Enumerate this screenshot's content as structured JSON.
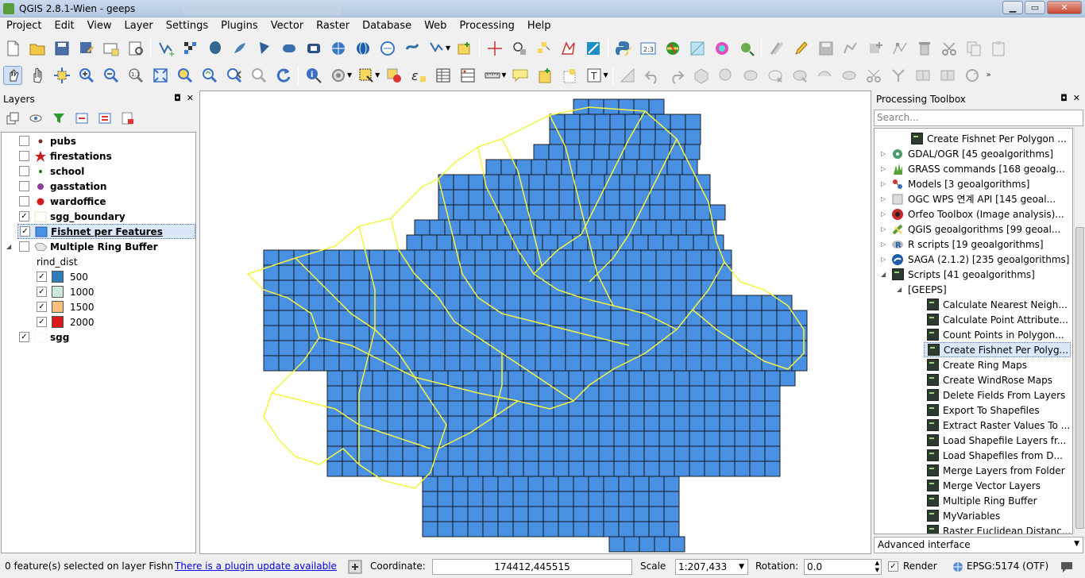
{
  "window": {
    "title": "QGIS 2.8.1-Wien - geeps",
    "minimize": "▁",
    "maximize": "▭",
    "close": "✕"
  },
  "menu": [
    "Project",
    "Edit",
    "View",
    "Layer",
    "Settings",
    "Plugins",
    "Vector",
    "Raster",
    "Database",
    "Web",
    "Processing",
    "Help"
  ],
  "layers_panel": {
    "title": "Layers",
    "float": "◘",
    "close": "✕",
    "layers": [
      {
        "name": "pubs",
        "checked": false,
        "symbol": "dot-brown"
      },
      {
        "name": "firestations",
        "checked": false,
        "symbol": "star-red"
      },
      {
        "name": "school",
        "checked": false,
        "symbol": "dot-green-small"
      },
      {
        "name": "gasstation",
        "checked": false,
        "symbol": "dot-purple"
      },
      {
        "name": "wardoffice",
        "checked": false,
        "symbol": "dot-red"
      },
      {
        "name": "sgg_boundary",
        "checked": true,
        "symbol": "fill-white"
      },
      {
        "name": "Fishnet per Features",
        "checked": true,
        "symbol": "fill-blue"
      },
      {
        "name": "Multiple Ring Buffer",
        "checked": false,
        "symbol": "polygon-group"
      },
      {
        "name": "sgg",
        "checked": true,
        "symbol": "fill-white"
      }
    ],
    "ring_field": "rind_dist",
    "classes": [
      {
        "label": "500",
        "color": "#2e7db8"
      },
      {
        "label": "1000",
        "color": "#cde9d9"
      },
      {
        "label": "1500",
        "color": "#fbc07c"
      },
      {
        "label": "2000",
        "color": "#d7191c"
      }
    ]
  },
  "processing": {
    "title": "Processing Toolbox",
    "search_placeholder": "Search...",
    "top_item": "Create Fishnet Per Polygon ...",
    "providers": [
      {
        "label": "GDAL/OGR [45 geoalgorithms]",
        "icon": "gdal-icon"
      },
      {
        "label": "GRASS commands [168 geoalg...",
        "icon": "grass-icon"
      },
      {
        "label": "Models [3 geoalgorithms]",
        "icon": "models-icon"
      },
      {
        "label": "OGC WPS 연계 API [145 geoal...",
        "icon": "ogc-wps-icon"
      },
      {
        "label": "Orfeo Toolbox (Image analysis)...",
        "icon": "orfeo-icon"
      },
      {
        "label": "QGIS geoalgorithms [99 geoal...",
        "icon": "qgis-icon"
      },
      {
        "label": "R scripts [19 geoalgorithms]",
        "icon": "r-icon"
      },
      {
        "label": "SAGA (2.1.2) [235 geoalgorithms]",
        "icon": "saga-icon"
      },
      {
        "label": "Scripts [41 geoalgorithms]",
        "icon": "scripts-icon"
      }
    ],
    "group": "[GEEPS]",
    "scripts": [
      "Calculate Nearest Neigh...",
      "Calculate Point Attribute...",
      "Count Points in Polygon...",
      "Create Fishnet Per Polyg...",
      "Create Ring Maps",
      "Create WindRose Maps",
      "Delete Fields From Layers",
      "Export To Shapefiles",
      "Extract Raster Values To ...",
      "Load Shapefile Layers fr...",
      "Load Shapefiles from D...",
      "Merge Layers from Folder",
      "Merge Vector Layers",
      "Multiple Ring Buffer",
      "MyVariables",
      "Raster Euclidean Distanc..."
    ],
    "mode": "Advanced interface"
  },
  "status": {
    "selection": "0 feature(s) selected on layer Fishn",
    "plugin_update": "There is a plugin update available",
    "coordinate_label": "Coordinate:",
    "coordinate": "174412,445515",
    "scale_label": "Scale",
    "scale": "1:207,433",
    "rotation_label": "Rotation:",
    "rotation": "0.0",
    "render_label": "Render",
    "epsg": "EPSG:5174 (OTF)"
  },
  "colors": {
    "fishnet_fill": "#4a90e2",
    "boundary": "#f4f442",
    "accent": "#3a6fc4"
  }
}
